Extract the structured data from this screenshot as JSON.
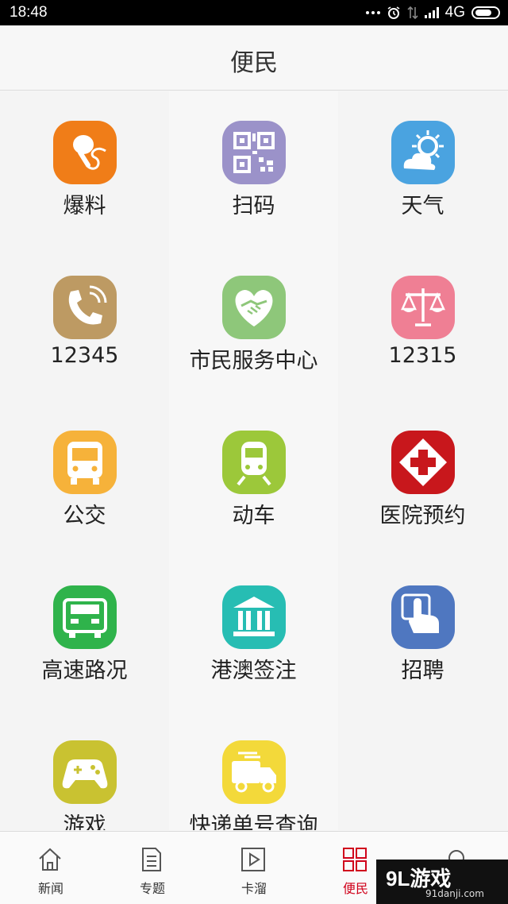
{
  "status_bar": {
    "time": "18:48",
    "network": "4G"
  },
  "header": {
    "title": "便民"
  },
  "grid": {
    "items": [
      {
        "label": "爆料",
        "icon": "microphone-icon",
        "color": "#f07d18"
      },
      {
        "label": "扫码",
        "icon": "qr-code-icon",
        "color": "#9b92c9"
      },
      {
        "label": "天气",
        "icon": "weather-sun-cloud-icon",
        "color": "#4aa3e0"
      },
      {
        "label": "12345",
        "icon": "phone-icon",
        "color": "#bd9a63"
      },
      {
        "label": "市民服务中心",
        "icon": "handshake-heart-icon",
        "color": "#8ec77a"
      },
      {
        "label": "12315",
        "icon": "scales-icon",
        "color": "#ef7f94"
      },
      {
        "label": "公交",
        "icon": "bus-icon",
        "color": "#f6b23a"
      },
      {
        "label": "动车",
        "icon": "train-icon",
        "color": "#9cc83a"
      },
      {
        "label": "医院预约",
        "icon": "hospital-cross-icon",
        "color": "#c8171c"
      },
      {
        "label": "高速路况",
        "icon": "truck-front-icon",
        "color": "#2fb34b"
      },
      {
        "label": "港澳签注",
        "icon": "government-building-icon",
        "color": "#27bdb3"
      },
      {
        "label": "招聘",
        "icon": "pointing-hand-icon",
        "color": "#4f77c0"
      },
      {
        "label": "游戏",
        "icon": "gamepad-icon",
        "color": "#c9c231"
      },
      {
        "label": "快递单号查询",
        "icon": "delivery-truck-icon",
        "color": "#f3d93a"
      }
    ]
  },
  "bottom_nav": {
    "items": [
      {
        "label": "新闻",
        "icon": "home-icon",
        "active": false
      },
      {
        "label": "专题",
        "icon": "document-icon",
        "active": false
      },
      {
        "label": "卡溜",
        "icon": "play-icon",
        "active": false
      },
      {
        "label": "便民",
        "icon": "grid-icon",
        "active": true
      },
      {
        "label": "",
        "icon": "search-icon",
        "active": false
      }
    ],
    "active_color": "#d0021b"
  },
  "watermark": {
    "main": "9L游戏",
    "sub": "91danji.com"
  }
}
